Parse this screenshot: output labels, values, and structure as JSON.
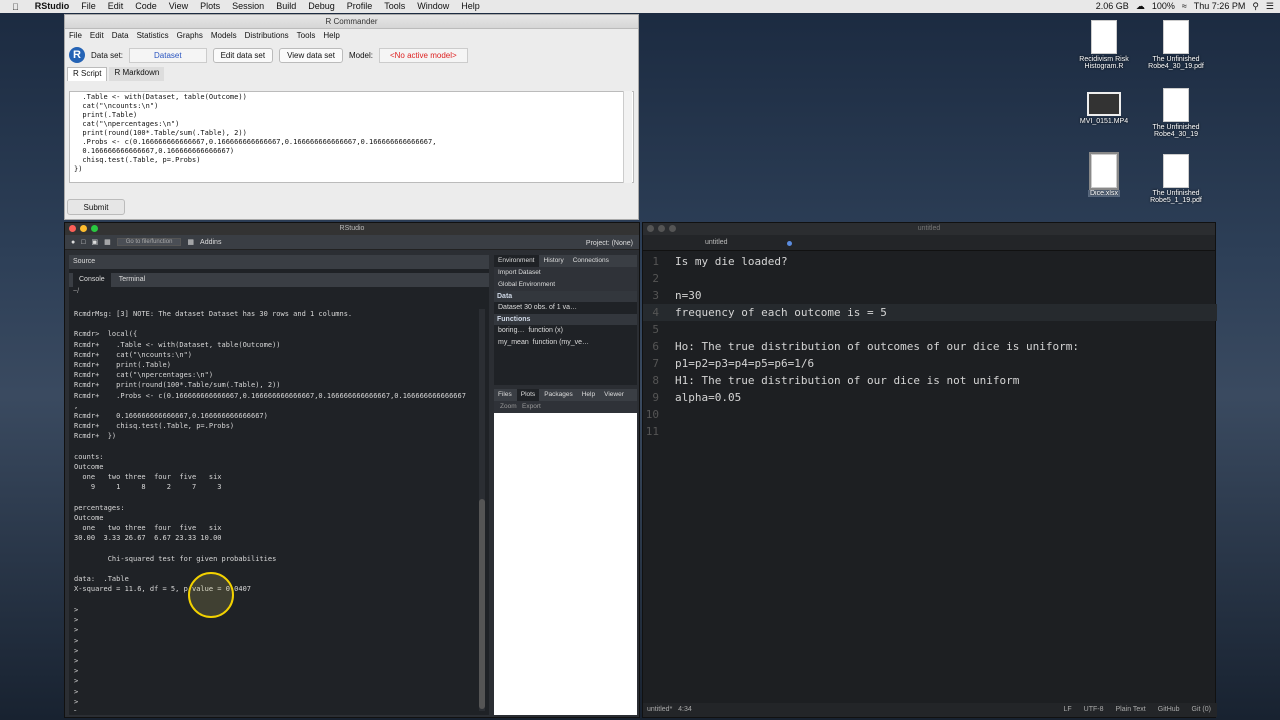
{
  "menubar": {
    "app": "RStudio",
    "items": [
      "File",
      "Edit",
      "Code",
      "View",
      "Plots",
      "Session",
      "Build",
      "Debug",
      "Profile",
      "Tools",
      "Window",
      "Help"
    ],
    "status": {
      "memory": "2.06 GB",
      "battery": "100%",
      "clock": "Thu 7:26 PM"
    }
  },
  "rcommander": {
    "title": "R Commander",
    "menu": [
      "File",
      "Edit",
      "Data",
      "Statistics",
      "Graphs",
      "Models",
      "Distributions",
      "Tools",
      "Help"
    ],
    "dataset_label": "Data set:",
    "dataset_value": "Dataset",
    "edit_button": "Edit data set",
    "view_button": "View data set",
    "model_label": "Model:",
    "model_value": "<No active model>",
    "tabs": [
      "R Script",
      "R Markdown"
    ],
    "script": "  .Table <- with(Dataset, table(Outcome))\n  cat(\"\\ncounts:\\n\")\n  print(.Table)\n  cat(\"\\npercentages:\\n\")\n  print(round(100*.Table/sum(.Table), 2))\n  .Probs <- c(0.166666666666667,0.166666666666667,0.166666666666667,0.166666666666667,\n  0.166666666666667,0.166666666666667)\n  chisq.test(.Table, p=.Probs)\n})",
    "submit": "Submit"
  },
  "rstudio": {
    "title": "RStudio",
    "goto": "Go to file/function",
    "addins": "Addins",
    "project": "Project: (None)",
    "source_label": "Source",
    "console_tabs": [
      "Console",
      "Terminal"
    ],
    "console_path": "~/",
    "console": "RcmdrMsg: [3] NOTE: The dataset Dataset has 30 rows and 1 columns.\n\nRcmdr>  local({\nRcmdr+    .Table <- with(Dataset, table(Outcome))\nRcmdr+    cat(\"\\ncounts:\\n\")\nRcmdr+    print(.Table)\nRcmdr+    cat(\"\\npercentages:\\n\")\nRcmdr+    print(round(100*.Table/sum(.Table), 2))\nRcmdr+    .Probs <- c(0.166666666666667,0.166666666666667,0.166666666666667,0.166666666666667\n,\nRcmdr+    0.166666666666667,0.166666666666667)\nRcmdr+    chisq.test(.Table, p=.Probs)\nRcmdr+  })\n\ncounts:\nOutcome\n  one   two three  four  five   six\n    9     1     8     2     7     3\n\npercentages:\nOutcome\n  one   two three  four  five   six\n30.00  3.33 26.67  6.67 23.33 10.00\n\n        Chi-squared test for given probabilities\n\ndata:  .Table\nX-squared = 11.6, df = 5, p-value = 0.0407\n\n>\n>\n>\n>\n>\n>\n>\n>\n>\n>\n>",
    "env_tabs": [
      "Environment",
      "History",
      "Connections"
    ],
    "import_label": "Import Dataset",
    "global_env": "Global Environment",
    "data_header": "Data",
    "data_row": "Dataset  30 obs. of 1 va…",
    "functions_header": "Functions",
    "functions": [
      {
        "name": "boring…",
        "value": "function (x)"
      },
      {
        "name": "my_mean",
        "value": "function (my_ve…"
      }
    ],
    "files_tabs": [
      "Files",
      "Plots",
      "Packages",
      "Help",
      "Viewer"
    ],
    "zoom": "Zoom",
    "export": "Export"
  },
  "editor": {
    "title": "untitled",
    "tab": "untitled",
    "lines": [
      "Is my die loaded?",
      "",
      "n=30",
      "frequency of each outcome is = 5",
      "",
      "Ho: The true distribution of outcomes of our dice is uniform:",
      "p1=p2=p3=p4=p5=p6=1/6",
      "H1: The true distribution of our dice is not uniform",
      "alpha=0.05",
      "",
      ""
    ],
    "status_left": "untitled*",
    "status_pos": "4:34",
    "status_right": [
      "LF",
      "UTF-8",
      "Plain Text",
      "GitHub",
      "Git (0)"
    ]
  },
  "desktop": {
    "icons": [
      {
        "label": "Recidivism Risk Histogram.R"
      },
      {
        "label": "The Unfinished Robe4_30_19.pdf"
      },
      {
        "label": "MVI_0151.MP4"
      },
      {
        "label": "The Unfinished Robe4_30_19"
      },
      {
        "label": "Dice.xlsx"
      },
      {
        "label": "The Unfinished Robe5_1_19.pdf"
      }
    ]
  }
}
